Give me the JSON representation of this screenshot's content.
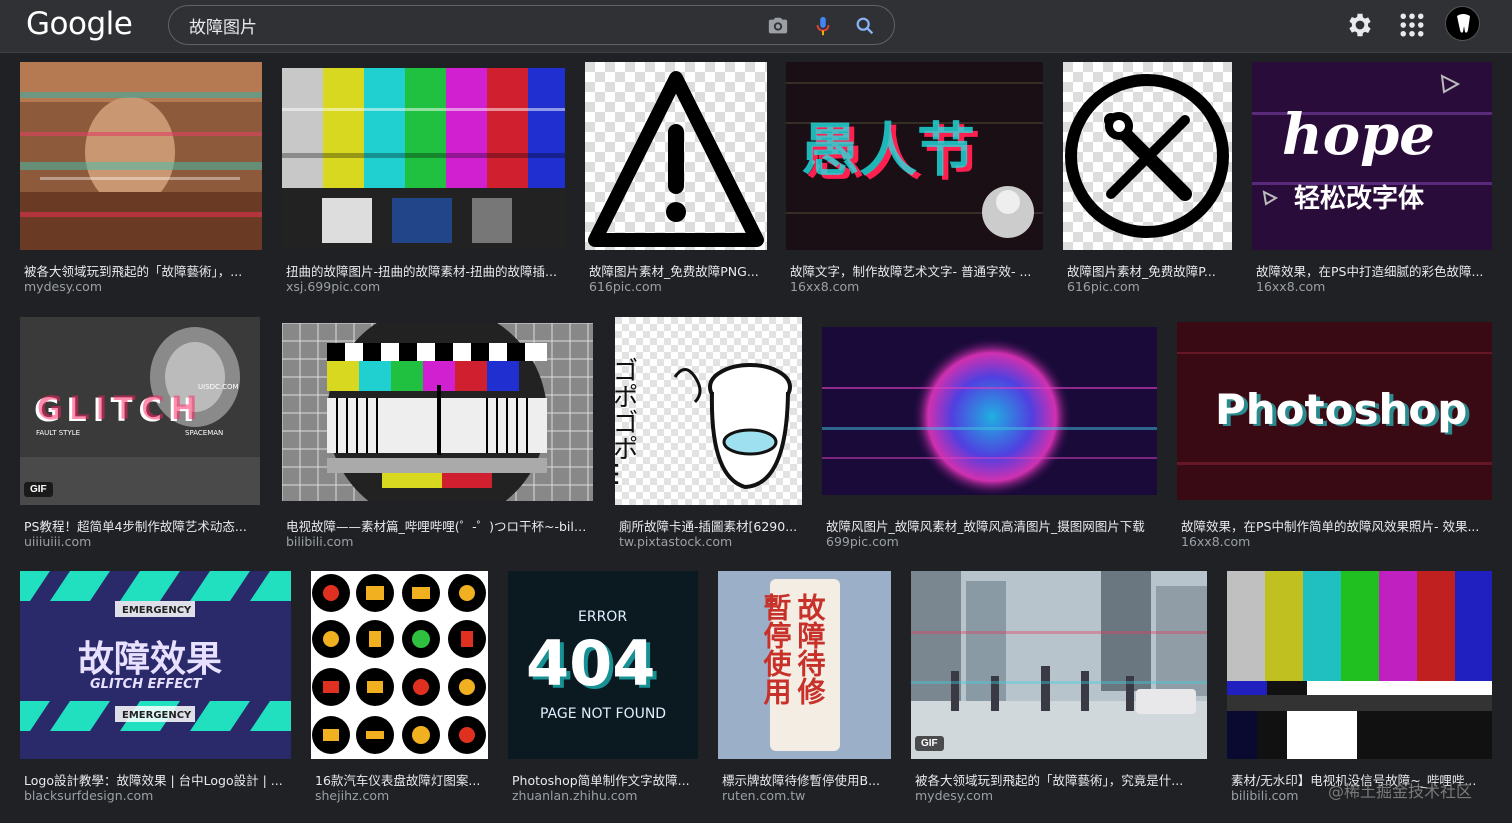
{
  "header": {
    "logo": "Google",
    "search_value": "故障图片"
  },
  "icons": {
    "camera": "camera-icon",
    "mic": "microphone-icon",
    "search": "search-icon",
    "settings": "gear-icon",
    "apps": "apps-grid-icon"
  },
  "colors": {
    "background": "#202124",
    "topbar": "#303134",
    "title_text": "#e8eaed",
    "source_text": "#9aa0a6"
  },
  "results": [
    {
      "title": "被各大领域玩到飛起的「故障藝術」，...",
      "source": "mydesy.com"
    },
    {
      "title": "扭曲的故障图片-扭曲的故障素材-扭曲的故障插...",
      "source": "xsj.699pic.com"
    },
    {
      "title": "故障图片素材_免费故障PNG...",
      "source": "616pic.com"
    },
    {
      "title": "故障文字，制作故障艺术文字- 普通字效- ...",
      "source": "16xx8.com"
    },
    {
      "title": "故障图片素材_免费故障P...",
      "source": "616pic.com"
    },
    {
      "title": "故障效果，在PS中打造细腻的彩色故障...",
      "source": "16xx8.com"
    },
    {
      "title": "PS教程！超简单4步制作故障艺术动态...",
      "source": "uiiiuiii.com",
      "badge": "GIF"
    },
    {
      "title": "电视故障——素材篇_哔哩哔哩(゜-゜)つロ干杯~-bilibili",
      "source": "bilibili.com"
    },
    {
      "title": "廁所故障卡通-插圖素材[6290...",
      "source": "tw.pixtastock.com"
    },
    {
      "title": "故障风图片_故障风素材_故障风高清图片_摄图网图片下载",
      "source": "699pic.com"
    },
    {
      "title": "故障效果，在PS中制作简单的故障风效果照片- 效果...",
      "source": "16xx8.com"
    },
    {
      "title": "Logo設計教學：故障效果 | 台中Logo設計 | ...",
      "source": "blacksurfdesign.com"
    },
    {
      "title": "16款汽车仪表盘故障灯图案...",
      "source": "shejihz.com"
    },
    {
      "title": "Photoshop简单制作文字故障...",
      "source": "zhuanlan.zhihu.com"
    },
    {
      "title": "標示牌故障待修暫停使用B...",
      "source": "ruten.com.tw"
    },
    {
      "title": "被各大领域玩到飛起的「故障藝術」，究竟是什...",
      "source": "mydesy.com",
      "badge": "GIF"
    },
    {
      "title": "素材/无水印】电视机没信号故障~_哔哩哔...",
      "source": "bilibili.com"
    }
  ],
  "image_text": {
    "aprilfools": "愚人节",
    "hope": "hope",
    "hope_sub": "轻松改字体",
    "glitch": "GLITCH",
    "glitch_small1": "FAULT STYLE",
    "glitch_small2": "SPACEMAN",
    "glitch_small3": "UISDC.COM",
    "gogo": "ゴポゴポ…",
    "photoshop": "Photoshop",
    "emergency": "EMERGENCY",
    "glitch_cn": "故障效果",
    "glitch_effect": "GLITCH EFFECT",
    "error": "ERROR",
    "e404": "404",
    "notfound": "PAGE NOT FOUND",
    "sign_col1": "故障待修",
    "sign_col2": "暫停使用"
  },
  "watermark": "@稀土掘金技术社区"
}
